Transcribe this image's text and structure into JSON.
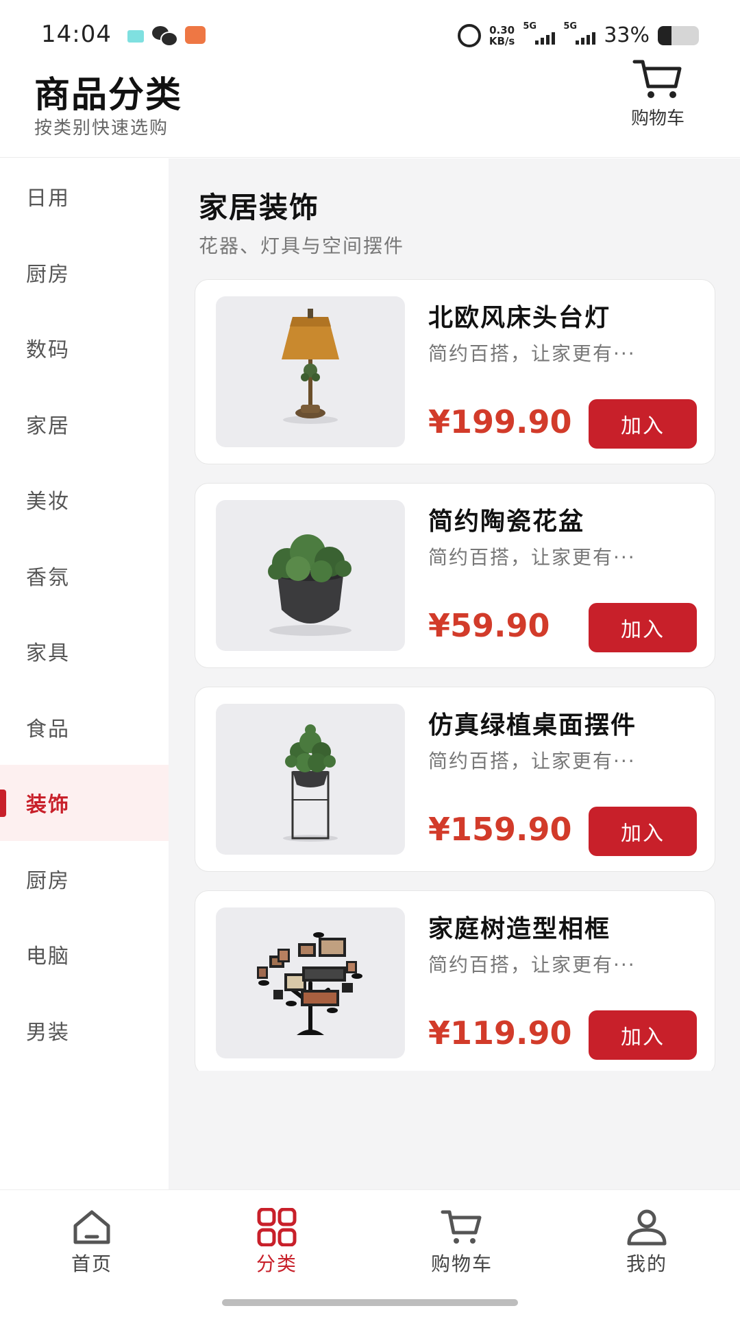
{
  "status_bar": {
    "time": "14:04",
    "net_speed_value": "0.30",
    "net_speed_unit": "KB/s",
    "signal_1_label": "5G",
    "signal_2_label": "5G",
    "battery_percent_text": "33%",
    "battery_level": 0.33,
    "icons": [
      "message-app-icon",
      "wechat-icon",
      "bilibili-icon",
      "alarm-icon",
      "signal-icon",
      "battery-icon"
    ]
  },
  "header": {
    "title": "商品分类",
    "subtitle": "按类别快速选购",
    "cart_label": "购物车",
    "cart_icon": "cart-icon"
  },
  "sidebar": {
    "items": [
      {
        "label": "日用",
        "active": false
      },
      {
        "label": "厨房",
        "active": false
      },
      {
        "label": "数码",
        "active": false
      },
      {
        "label": "家居",
        "active": false
      },
      {
        "label": "美妆",
        "active": false
      },
      {
        "label": "香氛",
        "active": false
      },
      {
        "label": "家具",
        "active": false
      },
      {
        "label": "食品",
        "active": false
      },
      {
        "label": "装饰",
        "active": true
      },
      {
        "label": "厨房",
        "active": false
      },
      {
        "label": "电脑",
        "active": false
      },
      {
        "label": "男装",
        "active": false
      }
    ]
  },
  "category": {
    "title": "家居装饰",
    "subtitle": "花器、灯具与空间摆件"
  },
  "products": [
    {
      "name": "北欧风床头台灯",
      "desc": "简约百搭，让家更有···",
      "price": "¥199.90",
      "button": "加入",
      "image": "table-lamp"
    },
    {
      "name": "简约陶瓷花盆",
      "desc": "简约百搭，让家更有···",
      "price": "¥59.90",
      "button": "加入",
      "image": "ceramic-planter"
    },
    {
      "name": "仿真绿植桌面摆件",
      "desc": "简约百搭，让家更有···",
      "price": "¥159.90",
      "button": "加入",
      "image": "plant-stand"
    },
    {
      "name": "家庭树造型相框",
      "desc": "简约百搭，让家更有···",
      "price": "¥119.90",
      "button": "加入",
      "image": "family-tree-frame"
    }
  ],
  "bottom_nav": {
    "items": [
      {
        "label": "首页",
        "icon": "home-icon",
        "active": false
      },
      {
        "label": "分类",
        "icon": "category-grid-icon",
        "active": true
      },
      {
        "label": "购物车",
        "icon": "cart-icon",
        "active": false
      },
      {
        "label": "我的",
        "icon": "profile-icon",
        "active": false
      }
    ]
  },
  "colors": {
    "accent": "#c8202a",
    "price": "#d23b2a",
    "active_bg": "#fdf0f0",
    "main_bg": "#f4f4f5"
  }
}
